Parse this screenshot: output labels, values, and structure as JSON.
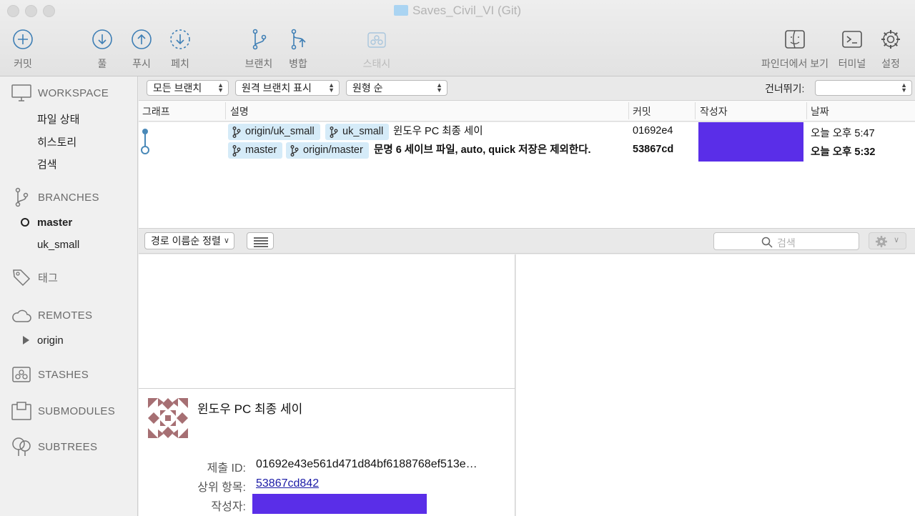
{
  "window": {
    "title": "Saves_Civil_VI (Git)"
  },
  "toolbar": {
    "commit": "커밋",
    "pull": "풀",
    "push": "푸시",
    "fetch": "페치",
    "branch": "브랜치",
    "merge": "병합",
    "stash": "스태시",
    "finder": "파인더에서 보기",
    "terminal": "터미널",
    "settings": "설정"
  },
  "sidebar": {
    "workspace": "WORKSPACE",
    "workspace_items": [
      "파일 상태",
      "히스토리",
      "검색"
    ],
    "branches": "BRANCHES",
    "branch_items": [
      "master",
      "uk_small"
    ],
    "tags": "태그",
    "remotes": "REMOTES",
    "remote_items": [
      "origin"
    ],
    "stashes": "STASHES",
    "submodules": "SUBMODULES",
    "subtrees": "SUBTREES"
  },
  "filterbar": {
    "branches_filter": "모든 브랜치",
    "remote_filter": "원격 브랜치 표시",
    "order_filter": "원형 순",
    "skip_label": "건너뛰기:"
  },
  "columns": {
    "graph": "그래프",
    "description": "설명",
    "commit": "커밋",
    "author": "작성자",
    "date": "날짜"
  },
  "commits": [
    {
      "tags": [
        "origin/uk_small",
        "uk_small"
      ],
      "message": "윈도우 PC 최종 세이",
      "hash": "01692e4",
      "date": "오늘 오후 5:47"
    },
    {
      "tags": [
        "master",
        "origin/master"
      ],
      "message": "문명 6 세이브 파일, auto, quick 저장은 제외한다.",
      "hash": "53867cd",
      "date": "오늘 오후 5:32"
    }
  ],
  "lowerbar": {
    "sort": "경로 이름순 정렬",
    "search_placeholder": "검색"
  },
  "detail": {
    "title": "윈도우 PC 최종 세이",
    "commit_id_label": "제출 ID:",
    "commit_id": "01692e43e561d471d84bf6188768ef513e…",
    "parent_label": "상위 항목:",
    "parent": "53867cd842",
    "author_label": "작성자:"
  },
  "colors": {
    "accent": "#5a2ee8",
    "tag_bg": "#d5ebf8",
    "graph": "#4a89b8"
  }
}
